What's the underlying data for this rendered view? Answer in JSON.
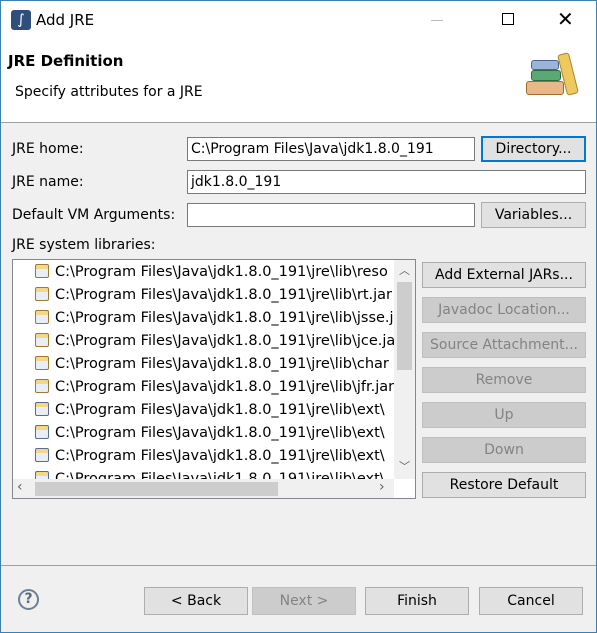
{
  "window": {
    "title": "Add JRE",
    "controls": [
      "minimize",
      "maximize",
      "close"
    ]
  },
  "header": {
    "title": "JRE Definition",
    "subtitle": "Specify attributes for a JRE",
    "icon": "library-books-icon"
  },
  "form": {
    "jre_home": {
      "label": "JRE home:",
      "value": "C:\\Program Files\\Java\\jdk1.8.0_191",
      "button": "Directory..."
    },
    "jre_name": {
      "label": "JRE name:",
      "value": "jdk1.8.0_191"
    },
    "vm_args": {
      "label": "Default VM Arguments:",
      "value": "",
      "button": "Variables..."
    },
    "libraries_label": "JRE system libraries:"
  },
  "libraries": [
    {
      "path": "C:\\Program Files\\Java\\jdk1.8.0_191\\jre\\lib\\reso"
    },
    {
      "path": "C:\\Program Files\\Java\\jdk1.8.0_191\\jre\\lib\\rt.jar"
    },
    {
      "path": "C:\\Program Files\\Java\\jdk1.8.0_191\\jre\\lib\\jsse.jar"
    },
    {
      "path": "C:\\Program Files\\Java\\jdk1.8.0_191\\jre\\lib\\jce.jar"
    },
    {
      "path": "C:\\Program Files\\Java\\jdk1.8.0_191\\jre\\lib\\char"
    },
    {
      "path": "C:\\Program Files\\Java\\jdk1.8.0_191\\jre\\lib\\jfr.jar"
    },
    {
      "path": "C:\\Program Files\\Java\\jdk1.8.0_191\\jre\\lib\\ext\\"
    },
    {
      "path": "C:\\Program Files\\Java\\jdk1.8.0_191\\jre\\lib\\ext\\"
    },
    {
      "path": "C:\\Program Files\\Java\\jdk1.8.0_191\\jre\\lib\\ext\\"
    },
    {
      "path": "C:\\Program Files\\Java\\jdk1.8.0_191\\jre\\lib\\ext\\"
    }
  ],
  "library_buttons": [
    {
      "label": "Add External JARs...",
      "enabled": true
    },
    {
      "label": "Javadoc Location...",
      "enabled": false
    },
    {
      "label": "Source Attachment...",
      "enabled": false
    },
    {
      "label": "Remove",
      "enabled": false
    },
    {
      "label": "Up",
      "enabled": false
    },
    {
      "label": "Down",
      "enabled": false
    },
    {
      "label": "Restore Default",
      "enabled": true
    }
  ],
  "footer": {
    "back": "< Back",
    "next": "Next >",
    "finish": "Finish",
    "cancel": "Cancel"
  }
}
